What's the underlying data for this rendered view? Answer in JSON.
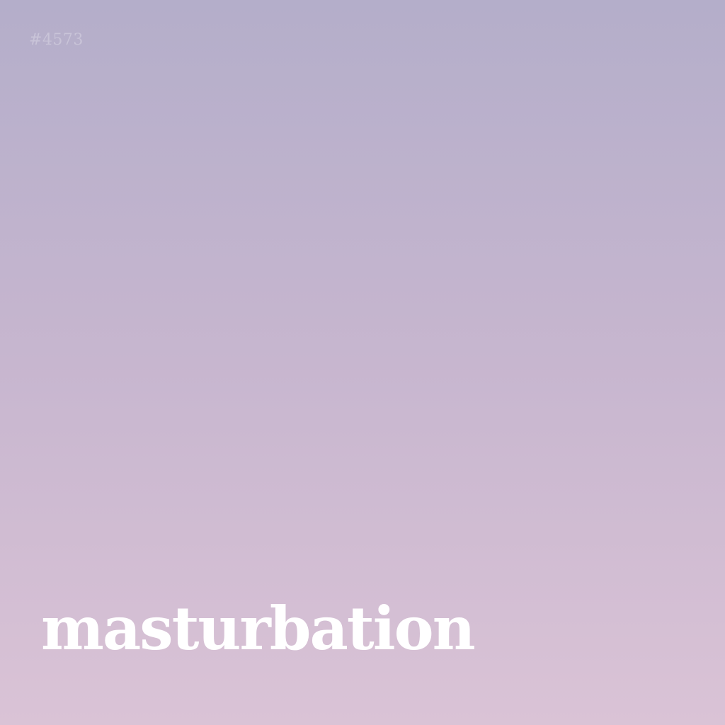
{
  "id_tag": "#4573",
  "word": "masturbation",
  "colors": {
    "gradient_top": "#b4aeca",
    "gradient_mid": "#c7b6cf",
    "gradient_bottom": "#dac3d6",
    "word_color": "#ffffff",
    "tag_color": "#c9c4d8"
  }
}
